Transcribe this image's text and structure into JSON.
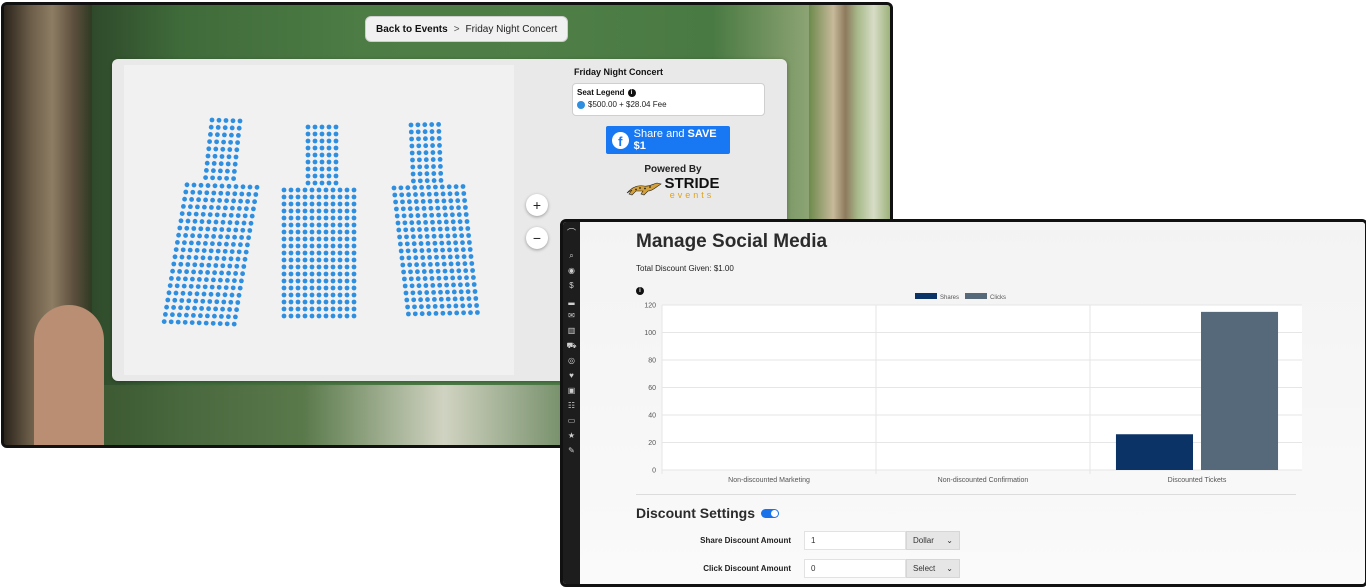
{
  "seat_page": {
    "breadcrumb": {
      "back": "Back to Events",
      "separator": ">",
      "current": "Friday Night Concert"
    },
    "event_title": "Friday Night Concert",
    "legend": {
      "title": "Seat Legend",
      "info_icon": "info-icon",
      "price": "$500.00 + $28.04 Fee",
      "seat_color": "#2e8fe0"
    },
    "share_button": {
      "text": "Share and ",
      "bold": "SAVE $1",
      "icon": "facebook-icon"
    },
    "powered_by": "Powered By",
    "brand": {
      "name": "STRIDE",
      "sub": "events"
    },
    "zoom_in": "+",
    "zoom_out": "−",
    "seat_sections": 3
  },
  "admin": {
    "nav_icons": [
      "logo",
      "search-icon",
      "palette-icon",
      "dollar-icon",
      "signal-icon",
      "mail-icon",
      "chart-icon",
      "cart-icon",
      "eye-icon",
      "heart-icon",
      "book-icon",
      "users-icon",
      "ticket-icon",
      "star-icon",
      "wrench-icon"
    ],
    "title": "Manage Social Media",
    "total_discount": "Total Discount Given: $1.00",
    "discount_settings": {
      "title": "Discount Settings",
      "toggle_on": true,
      "share_label": "Share Discount Amount",
      "share_value": "1",
      "share_type": "Dollar",
      "click_label": "Click Discount Amount",
      "click_value": "0",
      "click_type": "Select"
    }
  },
  "chart_data": {
    "type": "bar",
    "categories": [
      "Non-discounted Marketing",
      "Non-discounted Confirmation",
      "Discounted Tickets"
    ],
    "series": [
      {
        "name": "Shares",
        "values": [
          0,
          0,
          26
        ],
        "color": "#0b3366"
      },
      {
        "name": "Clicks",
        "values": [
          0,
          0,
          115
        ],
        "color": "#56697a"
      }
    ],
    "ylim": [
      0,
      120
    ],
    "yticks": [
      0,
      20,
      40,
      60,
      80,
      100,
      120
    ],
    "grid": true,
    "legend": "top-center",
    "title": "",
    "xlabel": "",
    "ylabel": ""
  }
}
